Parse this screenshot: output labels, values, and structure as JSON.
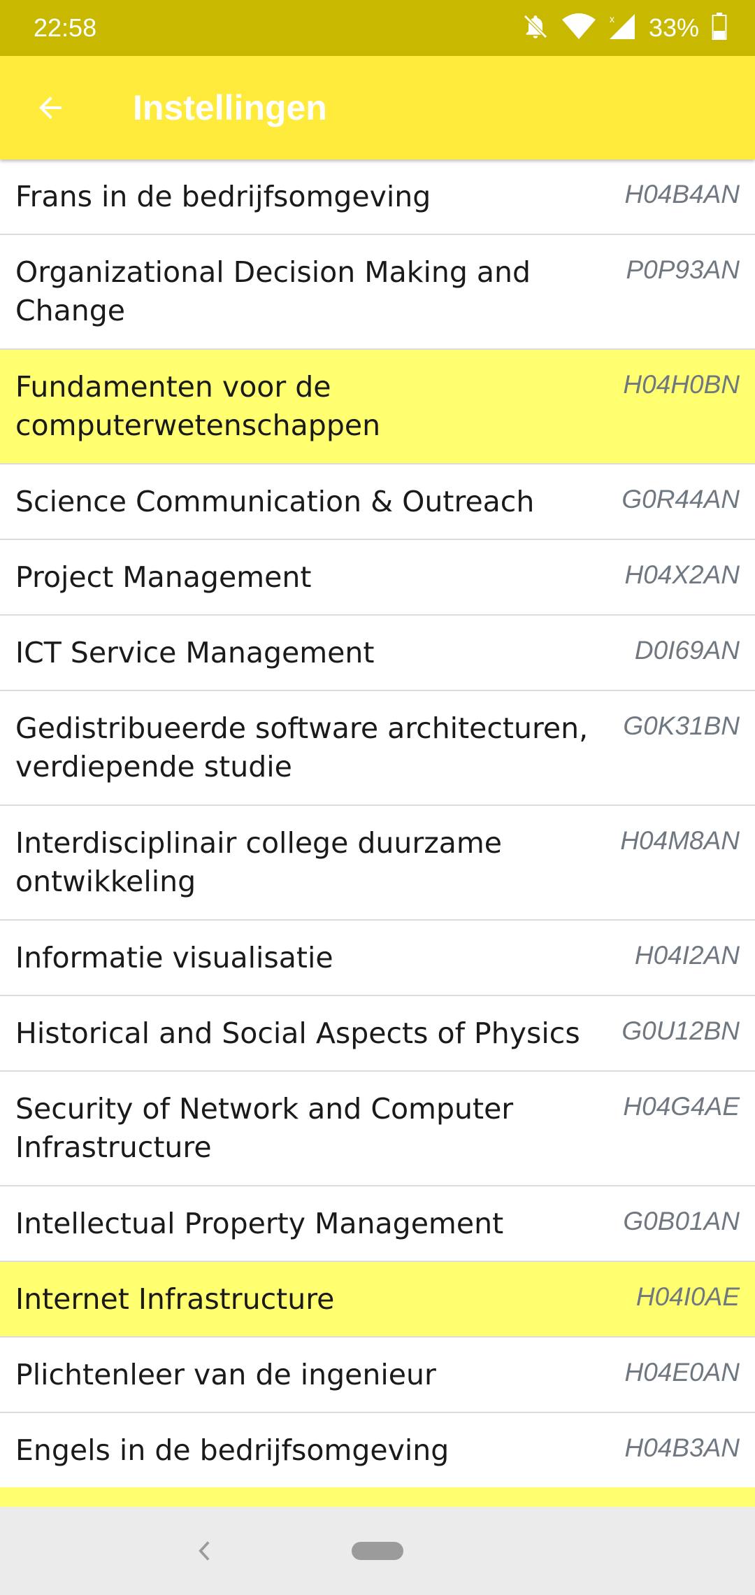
{
  "status_bar": {
    "time": "22:58",
    "battery_percent": "33%",
    "icons": [
      "notifications-off-icon",
      "wifi-icon",
      "cell-signal-icon",
      "battery-icon"
    ]
  },
  "app_bar": {
    "back_icon": "arrow-left-icon",
    "title": "Instellingen",
    "color": "#ffeb3b"
  },
  "courses": [
    {
      "name": "Frans in de bedrijfsomgeving",
      "code": "H04B4AN",
      "selected": false
    },
    {
      "name": "Organizational Decision Making and Change",
      "code": "P0P93AN",
      "selected": false
    },
    {
      "name": "Fundamenten voor de computerwetenschappen",
      "code": "H04H0BN",
      "selected": true
    },
    {
      "name": "Science Communication & Outreach",
      "code": "G0R44AN",
      "selected": false
    },
    {
      "name": "Project Management",
      "code": "H04X2AN",
      "selected": false
    },
    {
      "name": "ICT Service Management",
      "code": "D0I69AN",
      "selected": false
    },
    {
      "name": "Gedistribueerde software architecturen, verdiepende studie",
      "code": "G0K31BN",
      "selected": false
    },
    {
      "name": "Interdisciplinair college duurzame ontwikkeling",
      "code": "H04M8AN",
      "selected": false
    },
    {
      "name": "Informatie visualisatie",
      "code": "H04I2AN",
      "selected": false
    },
    {
      "name": "Historical and Social Aspects of Physics",
      "code": "G0U12BN",
      "selected": false
    },
    {
      "name": "Security of Network and Computer Infrastructure",
      "code": "H04G4AE",
      "selected": false
    },
    {
      "name": "Intellectual Property Management",
      "code": "G0B01AN",
      "selected": false
    },
    {
      "name": "Internet Infrastructure",
      "code": "H04I0AE",
      "selected": true
    },
    {
      "name": "Plichtenleer van de ingenieur",
      "code": "H04E0AN",
      "selected": false
    },
    {
      "name": "Engels in de bedrijfsomgeving",
      "code": "H04B3AN",
      "selected": false
    }
  ],
  "colors": {
    "status_bar": "#c9b800",
    "selected_row": "#ffff70",
    "code_text": "#6f7780"
  },
  "nav_bar": {
    "back_icon": "nav-back-icon",
    "home_icon": "home-pill-icon"
  }
}
